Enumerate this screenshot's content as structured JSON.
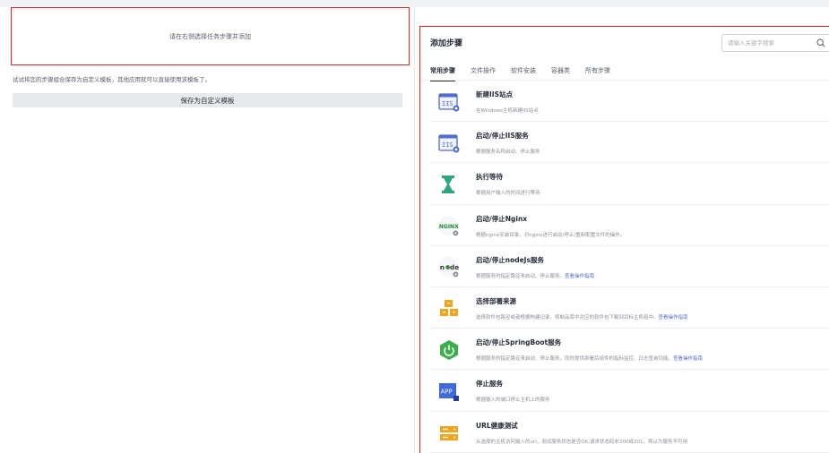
{
  "left": {
    "drop_zone_text": "请在右侧选择任务步骤并添加",
    "hint_text": "试试将您的步骤组合保存为自定义模板，其他应用就可以直接使用该模板了。",
    "save_button_label": "保存为自定义模板"
  },
  "panel": {
    "title": "添加步骤",
    "search_placeholder": "请输入关键字搜索",
    "tabs": [
      {
        "label": "常用步骤",
        "active": true
      },
      {
        "label": "文件操作",
        "active": false
      },
      {
        "label": "软件安装",
        "active": false
      },
      {
        "label": "容器类",
        "active": false
      },
      {
        "label": "所有步骤",
        "active": false
      }
    ],
    "items": [
      {
        "title": "新建IIS站点",
        "desc": "在Windows主机新建IIS站点",
        "link": "",
        "icon": "iis-site-icon"
      },
      {
        "title": "启动/停止IIS服务",
        "desc": "根据服务名称启动、停止服务",
        "link": "",
        "icon": "iis-service-icon"
      },
      {
        "title": "执行等待",
        "desc": "根据用户输入的时间进行等待",
        "link": "",
        "icon": "hourglass-icon"
      },
      {
        "title": "启动/停止Nginx",
        "desc": "根据nginx安装目录，对nginx进行启动/停止/重新配置文件的操作。",
        "link": "",
        "icon": "nginx-icon"
      },
      {
        "title": "启动/停止nodeJs服务",
        "desc": "根据服务的指定路径来启动、停止服务。",
        "link": "查看操作指南",
        "icon": "nodejs-icon"
      },
      {
        "title": "选择部署来源",
        "desc": "选择软件包路径或者根据构建记录，将制品库中对应的软件包下载到目标主机组中。",
        "link": "查看操作指南",
        "icon": "deploy-source-icon"
      },
      {
        "title": "启动/停止SpringBoot服务",
        "desc": "根据服务的指定路径来启动、停止服务。同时提供部署后组件的指标监控、日志查询功能。",
        "link": "查看操作指南",
        "icon": "springboot-icon"
      },
      {
        "title": "停止服务",
        "desc": "根据输入的端口停止主机上的服务",
        "link": "",
        "icon": "app-stop-icon"
      },
      {
        "title": "URL健康测试",
        "desc": "从选择的主机访问输入的url，测试服务状态是否OK,请求状态码非200或201，将认为服务不可用",
        "link": "",
        "icon": "url-health-icon"
      }
    ]
  },
  "colors": {
    "highlight_border": "#e5222a",
    "link": "#526ecc",
    "iis_blue": "#526ecc",
    "wait_green": "#2ea87a",
    "spring_green": "#3ab04a",
    "deploy_orange": "#f2a51a",
    "app_blue": "#3f6ad8"
  }
}
